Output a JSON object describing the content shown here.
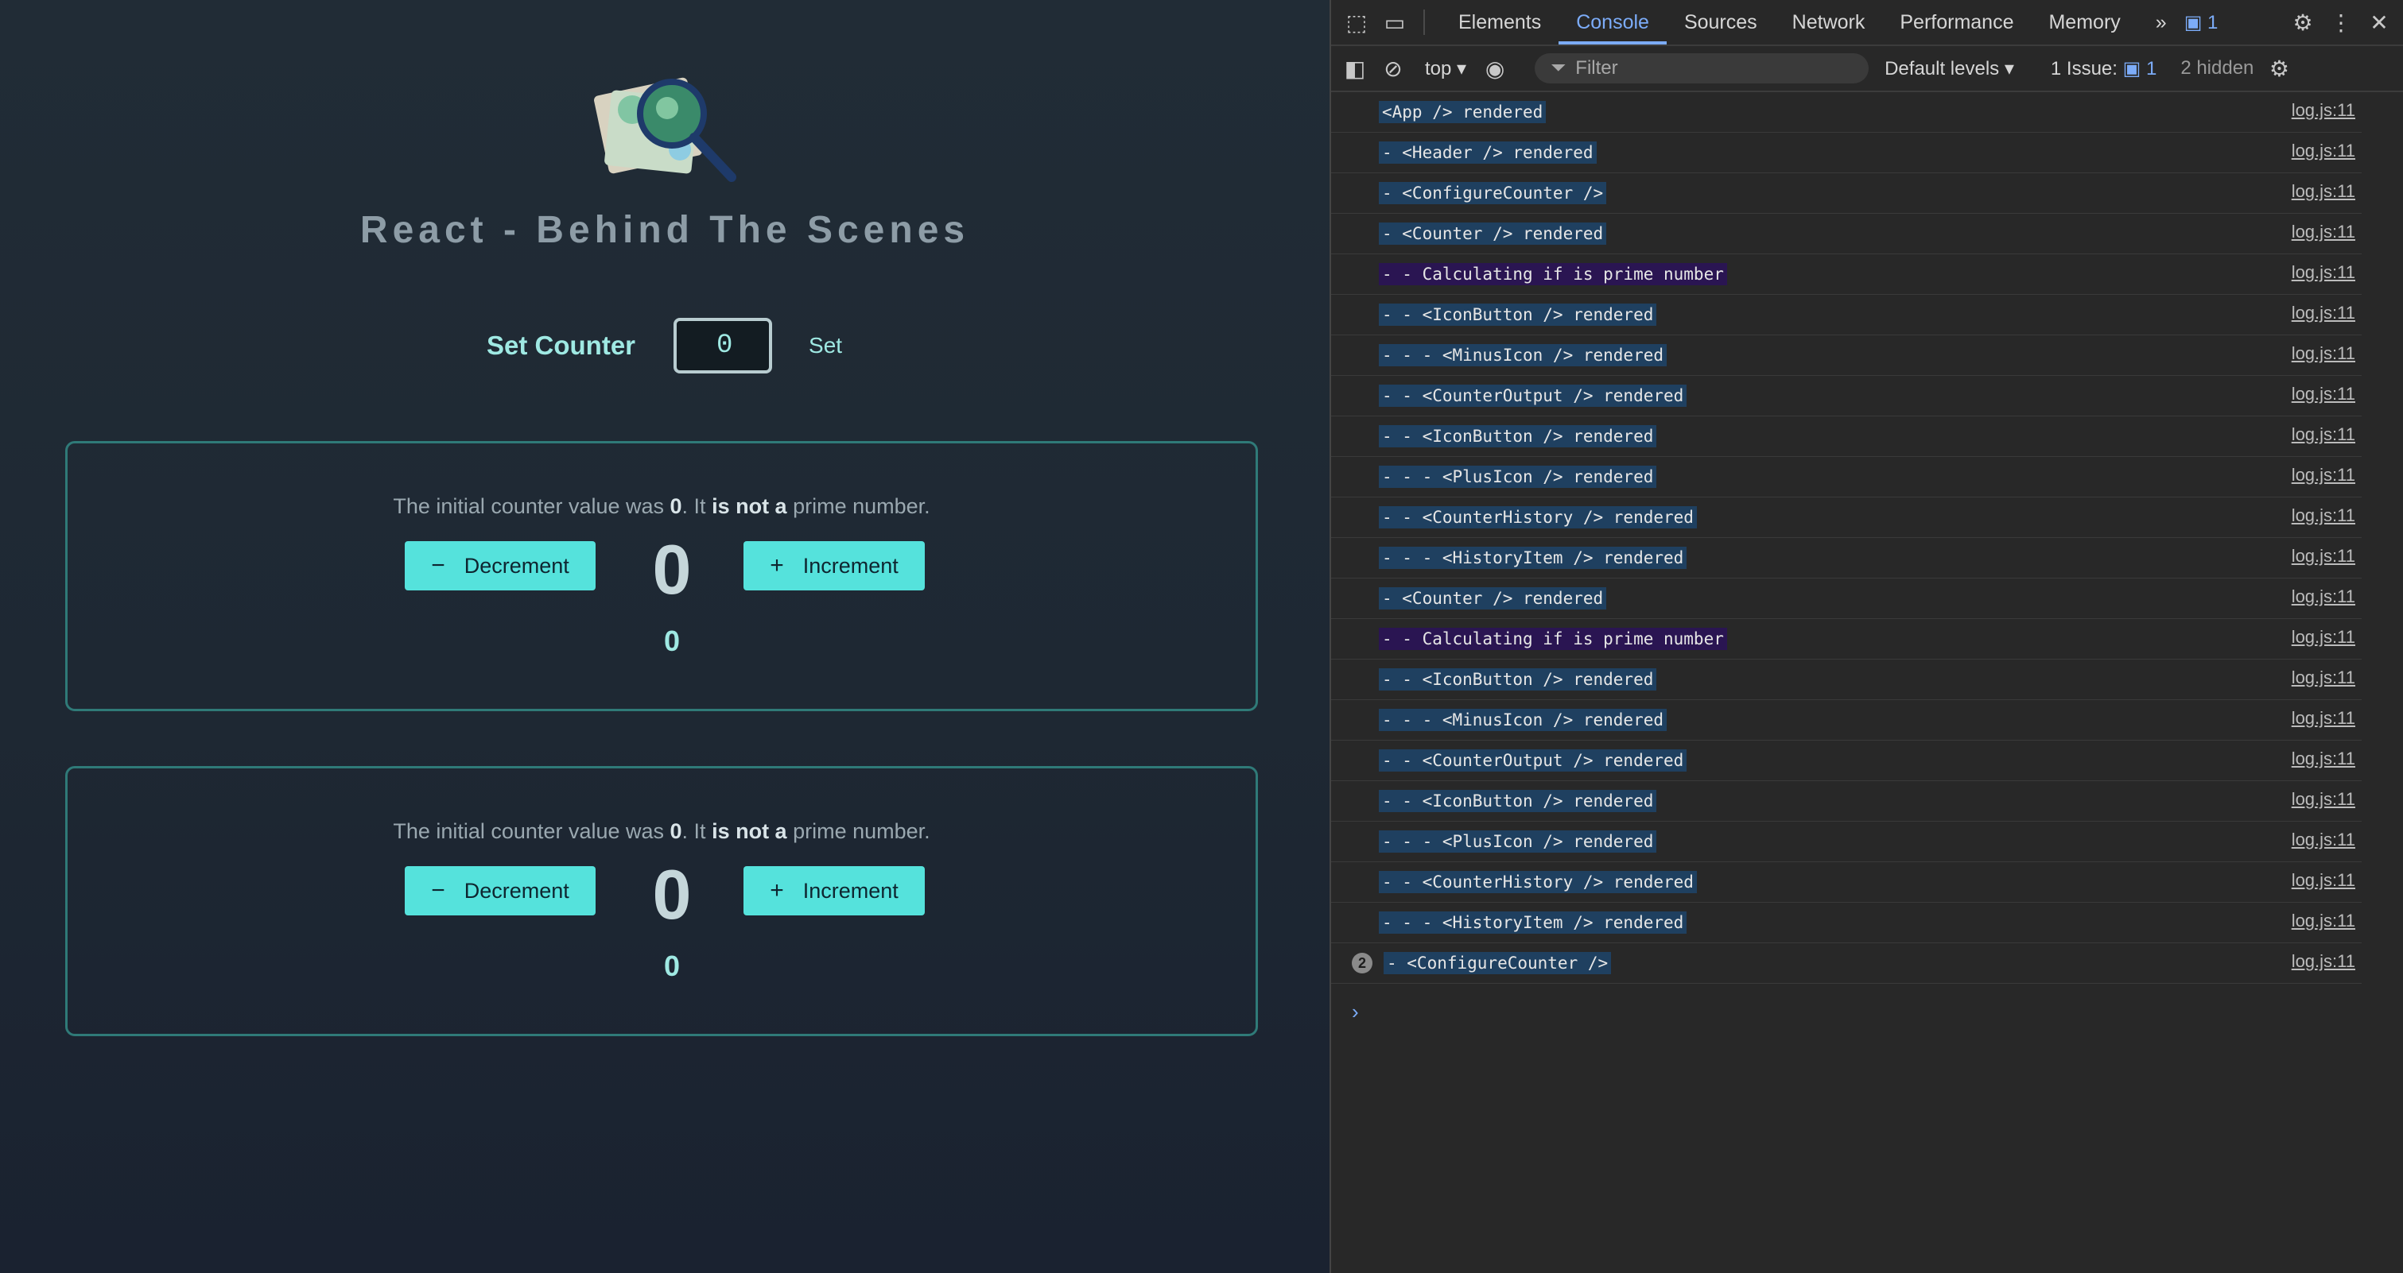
{
  "app": {
    "title": "React - Behind The Scenes",
    "configure": {
      "label": "Set Counter",
      "input_value": "0",
      "set_label": "Set"
    },
    "counters": [
      {
        "text_pre": "The initial counter value was ",
        "initial": "0",
        "text_mid": ". It ",
        "is_not": "is not a",
        "text_post": " prime number.",
        "decrement": "Decrement",
        "increment": "Increment",
        "value": "0",
        "history": "0"
      },
      {
        "text_pre": "The initial counter value was ",
        "initial": "0",
        "text_mid": ". It ",
        "is_not": "is not a",
        "text_post": " prime number.",
        "decrement": "Decrement",
        "increment": "Increment",
        "value": "0",
        "history": "0"
      }
    ]
  },
  "devtools": {
    "tabs": [
      "Elements",
      "Console",
      "Sources",
      "Network",
      "Performance",
      "Memory"
    ],
    "more_tabs": "»",
    "messages_badge": "1",
    "toolbar": {
      "context": "top",
      "filter_placeholder": "Filter",
      "levels": "Default levels",
      "issues_label": "1 Issue:",
      "issues_count": "1",
      "hidden": "2 hidden"
    },
    "log": [
      {
        "msg": "<App /> rendered",
        "src": "log.js:11"
      },
      {
        "msg": "- <Header /> rendered",
        "src": "log.js:11"
      },
      {
        "msg": "- <ConfigureCounter />",
        "src": "log.js:11"
      },
      {
        "msg": "- <Counter /> rendered",
        "src": "log.js:11"
      },
      {
        "msg": "- - Calculating if is prime number",
        "src": "log.js:11",
        "prime": true
      },
      {
        "msg": "- - <IconButton /> rendered",
        "src": "log.js:11"
      },
      {
        "msg": "- - - <MinusIcon /> rendered",
        "src": "log.js:11"
      },
      {
        "msg": "- - <CounterOutput /> rendered",
        "src": "log.js:11"
      },
      {
        "msg": "- - <IconButton /> rendered",
        "src": "log.js:11"
      },
      {
        "msg": "- - - <PlusIcon /> rendered",
        "src": "log.js:11"
      },
      {
        "msg": "- - <CounterHistory /> rendered",
        "src": "log.js:11"
      },
      {
        "msg": "- - - <HistoryItem /> rendered",
        "src": "log.js:11"
      },
      {
        "msg": "- <Counter /> rendered",
        "src": "log.js:11"
      },
      {
        "msg": "- - Calculating if is prime number",
        "src": "log.js:11",
        "prime": true
      },
      {
        "msg": "- - <IconButton /> rendered",
        "src": "log.js:11"
      },
      {
        "msg": "- - - <MinusIcon /> rendered",
        "src": "log.js:11"
      },
      {
        "msg": "- - <CounterOutput /> rendered",
        "src": "log.js:11"
      },
      {
        "msg": "- - <IconButton /> rendered",
        "src": "log.js:11"
      },
      {
        "msg": "- - - <PlusIcon /> rendered",
        "src": "log.js:11"
      },
      {
        "msg": "- - <CounterHistory /> rendered",
        "src": "log.js:11"
      },
      {
        "msg": "- - - <HistoryItem /> rendered",
        "src": "log.js:11"
      },
      {
        "msg": "- <ConfigureCounter />",
        "src": "log.js:11",
        "count": "2"
      }
    ],
    "prompt": "›"
  },
  "colors": {
    "accent": "#55e2dc",
    "devtools_link": "#7cacf8",
    "log_bg": "#1f4060",
    "prime_bg": "#2a1552"
  }
}
